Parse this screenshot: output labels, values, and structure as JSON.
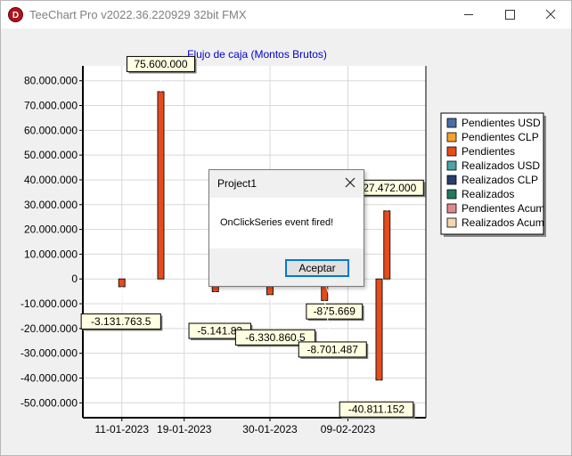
{
  "window": {
    "title": "TeeChart Pro v2022.36.220929 32bit FMX",
    "icon": "teechart-d-icon"
  },
  "chart_data": {
    "type": "bar",
    "title": "Flujo de caja (Montos Brutos)",
    "xlabel": "",
    "ylabel": "",
    "ylim": [
      -56000000,
      86000000
    ],
    "grid": true,
    "y_ticks": [
      80000000,
      70000000,
      60000000,
      50000000,
      40000000,
      30000000,
      20000000,
      10000000,
      0,
      -10000000,
      -20000000,
      -30000000,
      -40000000,
      -50000000
    ],
    "y_tick_labels": [
      "80.000.000",
      "70.000.000",
      "60.000.000",
      "50.000.000",
      "40.000.000",
      "30.000.000",
      "20.000.000",
      "10.000.000",
      "0",
      "-10.000.000",
      "-20.000.000",
      "-30.000.000",
      "-40.000.000",
      "-50.000.000"
    ],
    "x_range": [
      "2023-01-06",
      "2023-02-19"
    ],
    "x_ticks": [
      "2023-01-11",
      "2023-01-19",
      "2023-01-30",
      "2023-02-09"
    ],
    "x_tick_labels": [
      "11-01-2023",
      "19-01-2023",
      "30-01-2023",
      "09-02-2023"
    ],
    "legend_placement": "right",
    "legend": [
      {
        "name": "Pendientes USD",
        "color": "#4a6fa5"
      },
      {
        "name": "Pendientes CLP",
        "color": "#f5a030"
      },
      {
        "name": "Pendientes",
        "color": "#e84a1a"
      },
      {
        "name": "Realizados USD",
        "color": "#4aa3a8"
      },
      {
        "name": "Realizados CLP",
        "color": "#2b3d6b"
      },
      {
        "name": "Realizados",
        "color": "#227a5e"
      },
      {
        "name": "Pendientes Acum",
        "color": "#e08890"
      },
      {
        "name": "Realizados Acum",
        "color": "#efd9b0"
      }
    ],
    "series": [
      {
        "name": "Pendientes",
        "color": "#e84a1a",
        "points": [
          {
            "x": "2023-01-11",
            "y": -3131763.5,
            "label": "-3.131.763.5"
          },
          {
            "x": "2023-01-16",
            "y": 75600000,
            "label": "75.600.000"
          },
          {
            "x": "2023-01-23",
            "y": -5141830,
            "label": "-5.141.83"
          },
          {
            "x": "2023-01-30",
            "y": -6330860.5,
            "label": "-6.330.860.5"
          },
          {
            "x": "2023-02-06",
            "y": -875669,
            "label": "-875.669"
          },
          {
            "x": "2023-02-06",
            "y": -8701487,
            "label": "-8.701.487"
          },
          {
            "x": "2023-02-13",
            "y": -40811152,
            "label": "-40.811.152"
          },
          {
            "x": "2023-02-14",
            "y": 27472000,
            "label": "27.472.000"
          }
        ]
      }
    ]
  },
  "dialog": {
    "title": "Project1",
    "message": "OnClickSeries event fired!",
    "ok_label": "Aceptar"
  }
}
